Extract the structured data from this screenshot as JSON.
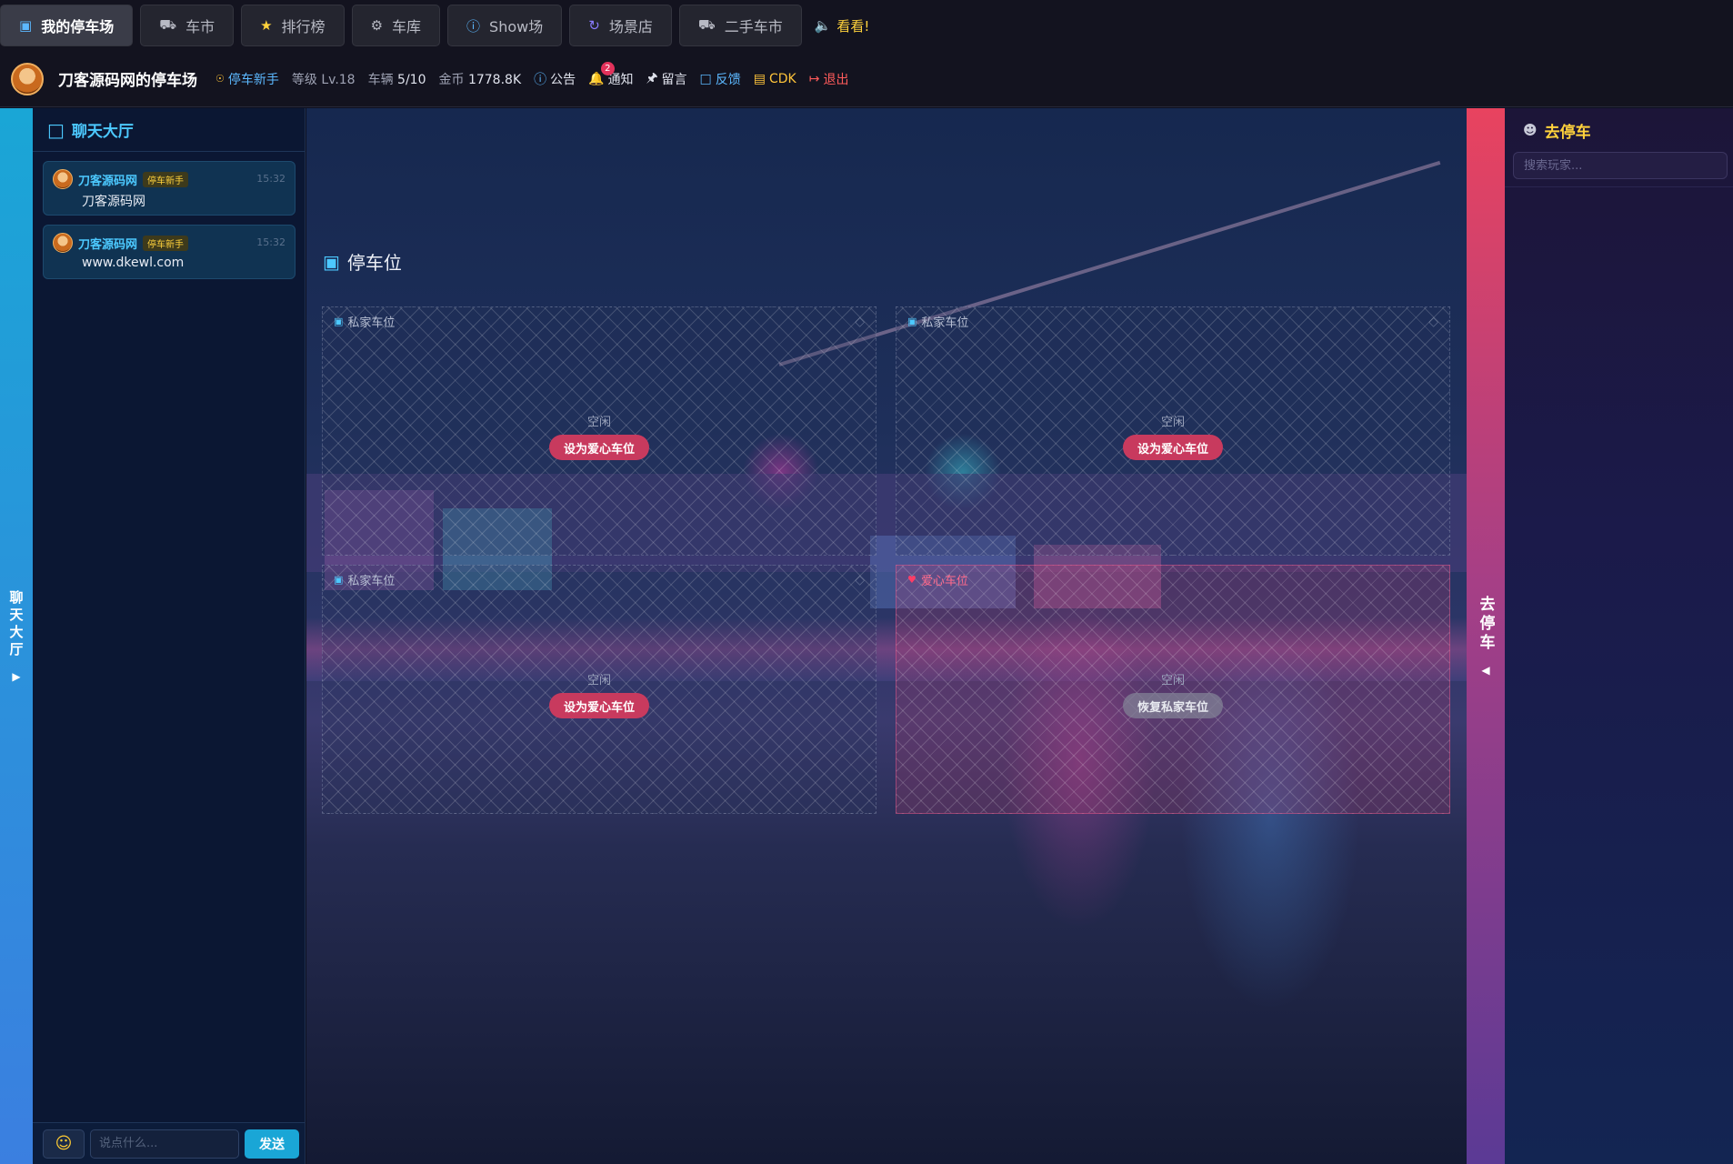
{
  "nav": {
    "tabs": [
      {
        "label": "我的停车场",
        "icon": "parking-icon",
        "active": true
      },
      {
        "label": "车市",
        "icon": "car-icon"
      },
      {
        "label": "排行榜",
        "icon": "star-icon"
      },
      {
        "label": "车库",
        "icon": "gear-icon"
      },
      {
        "label": "Show场",
        "icon": "info-icon"
      },
      {
        "label": "场景店",
        "icon": "refresh-icon"
      },
      {
        "label": "二手车市",
        "icon": "car-icon"
      }
    ],
    "announce": "看看!"
  },
  "info": {
    "park_name": "刀客源码网的停车场",
    "level_title": "停车新手",
    "level": "等级 Lv.18",
    "vehicles_label": "车辆",
    "vehicles": "5/10",
    "gold_label": "金币",
    "gold": "1778.8K",
    "notice": "公告",
    "notify": "通知",
    "notify_count": "2",
    "message": "留言",
    "feedback": "反馈",
    "cdk": "CDK",
    "logout": "退出"
  },
  "chat": {
    "edge_label": "聊天大厅",
    "title": "聊天大厅",
    "messages": [
      {
        "user": "刀客源码网",
        "tag": "停车新手",
        "time": "15:32",
        "text": "刀客源码网"
      },
      {
        "user": "刀客源码网",
        "tag": "停车新手",
        "time": "15:32",
        "text": "www.dkewl.com"
      }
    ],
    "input_placeholder": "说点什么...",
    "send_label": "发送"
  },
  "parking": {
    "title": "停车位",
    "slots": [
      {
        "type": "私家车位",
        "status": "空闲",
        "action": "设为爱心车位",
        "kind": "private"
      },
      {
        "type": "私家车位",
        "status": "空闲",
        "action": "设为爱心车位",
        "kind": "private"
      },
      {
        "type": "私家车位",
        "status": "空闲",
        "action": "设为爱心车位",
        "kind": "private"
      },
      {
        "type": "爱心车位",
        "status": "空闲",
        "action": "恢复私家车位",
        "kind": "love"
      }
    ]
  },
  "right": {
    "edge_label": "去停车",
    "title": "去停车",
    "search_placeholder": "搜索玩家..."
  },
  "colors": {
    "accent_cyan": "#4cc9ff",
    "gold": "#ffd23c",
    "love_red": "#c83a5e",
    "danger": "#ff5b5b"
  }
}
